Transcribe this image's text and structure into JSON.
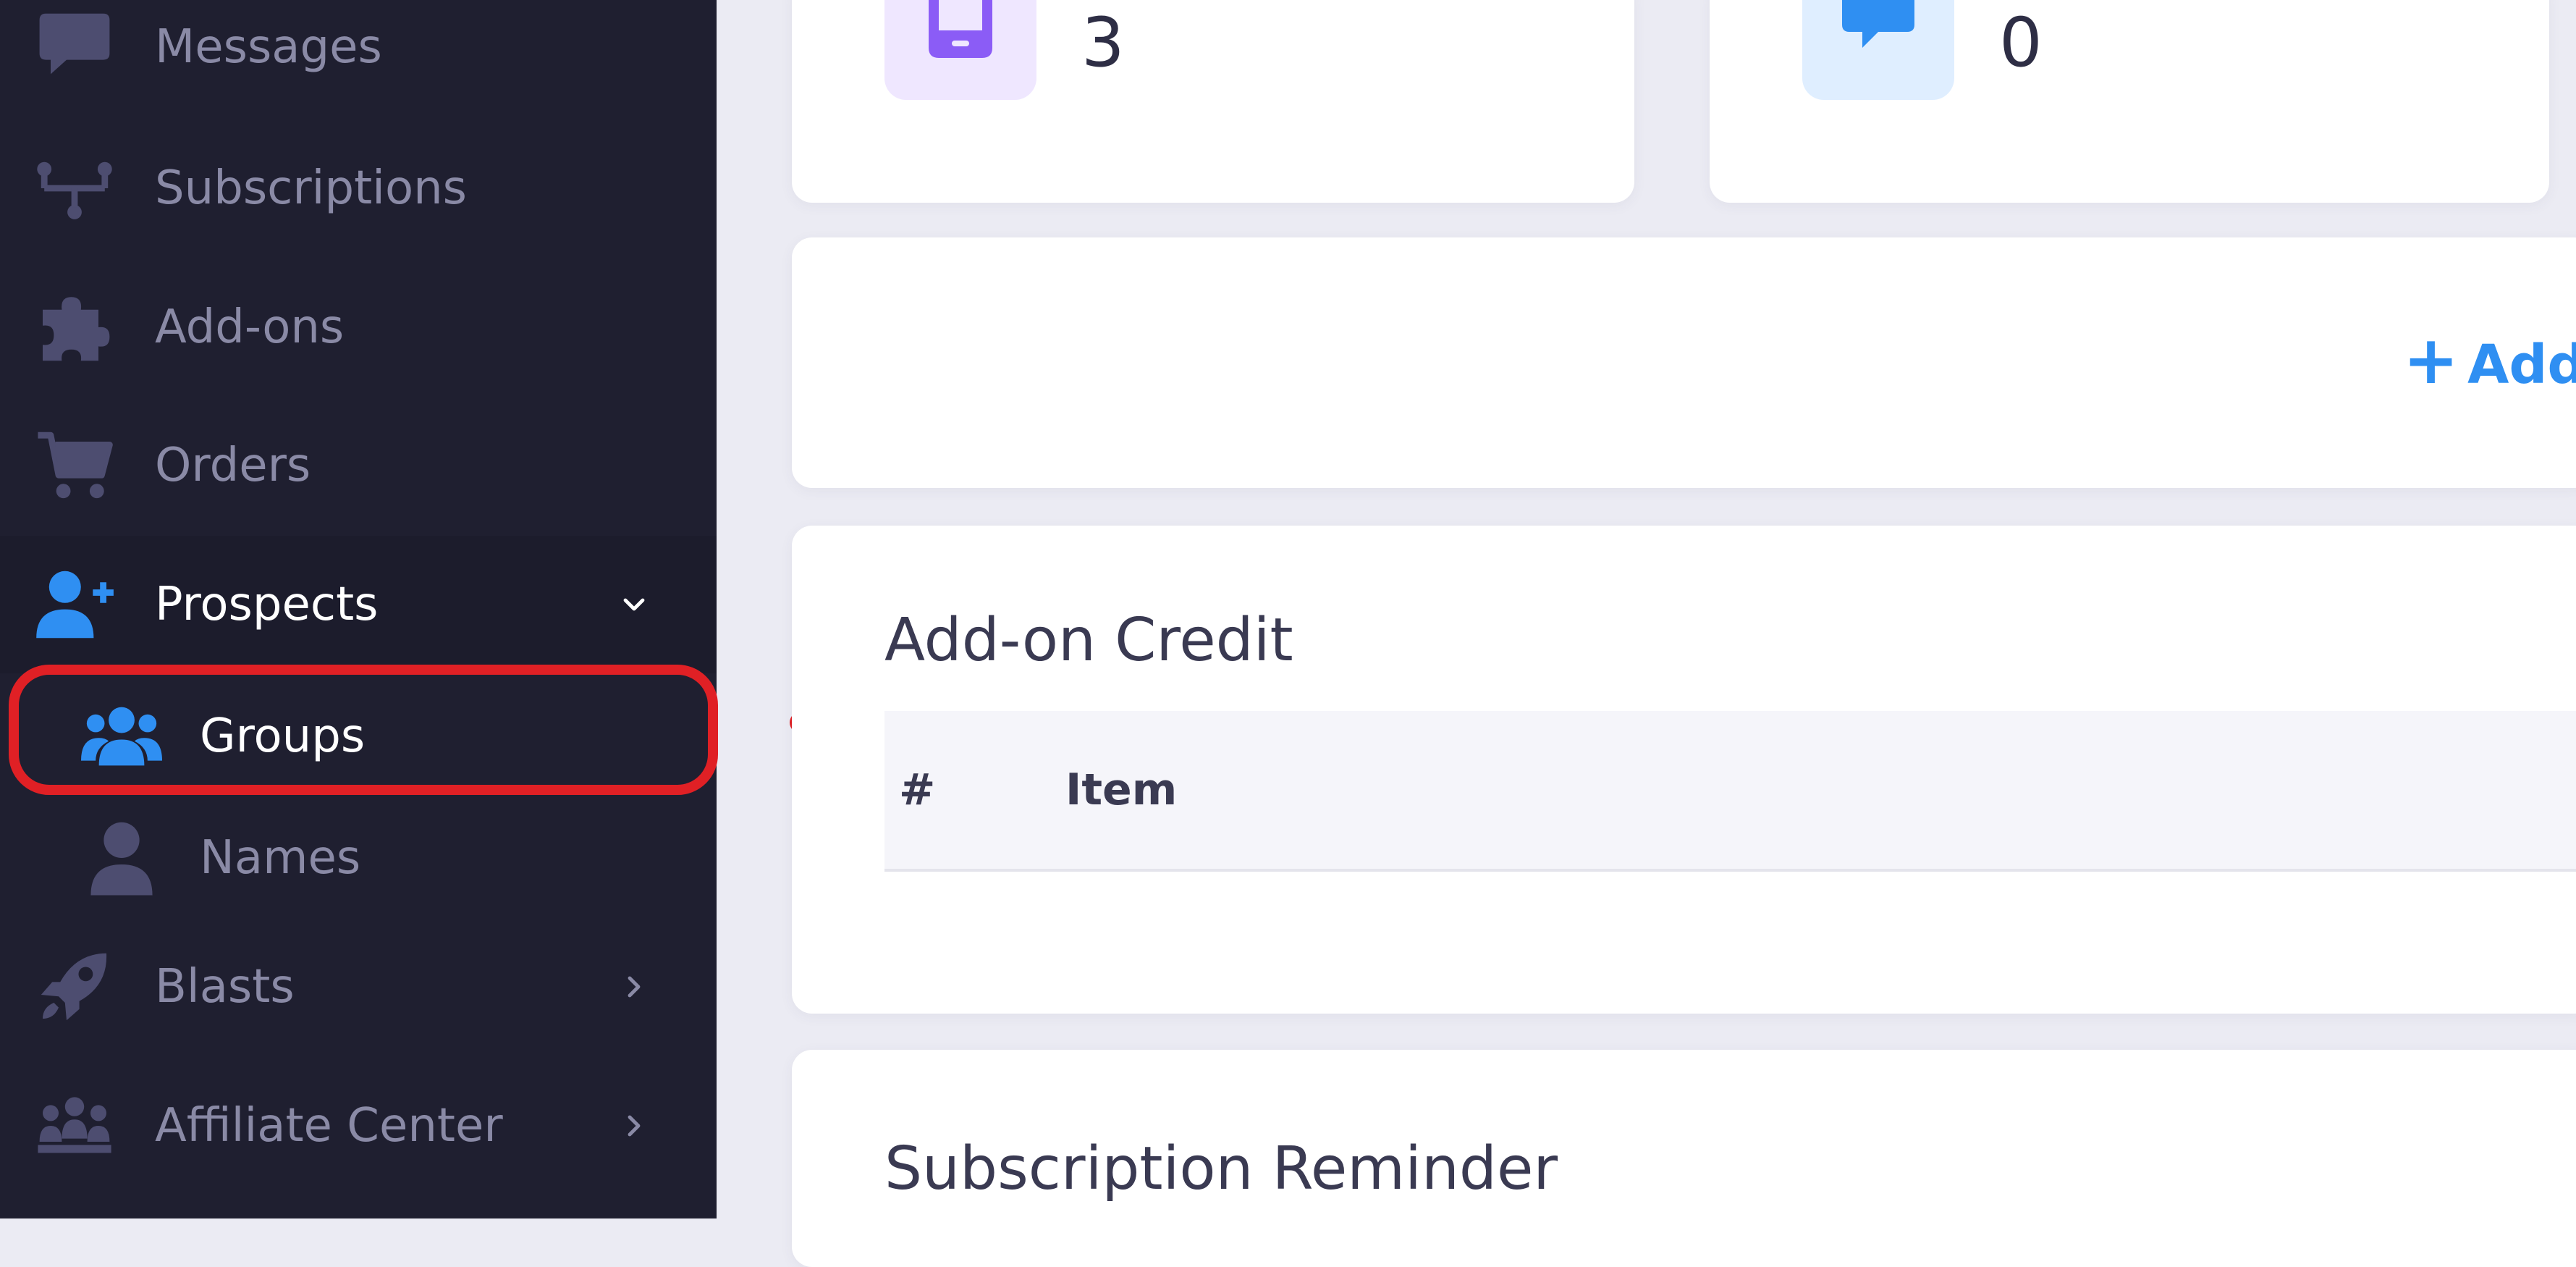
{
  "sidebar": {
    "items": [
      {
        "label": "Messages",
        "icon": "chat-bubble-icon"
      },
      {
        "label": "Subscriptions",
        "icon": "sitemap-icon"
      },
      {
        "label": "Add-ons",
        "icon": "puzzle-icon"
      },
      {
        "label": "Orders",
        "icon": "cart-icon"
      },
      {
        "label": "Prospects",
        "icon": "user-plus-icon",
        "expanded": true
      },
      {
        "label": "Blasts",
        "icon": "rocket-icon"
      },
      {
        "label": "Affiliate Center",
        "icon": "people-group-icon"
      }
    ],
    "prospects_sub": [
      {
        "label": "Groups",
        "icon": "users-icon",
        "active": true
      },
      {
        "label": "Names",
        "icon": "user-icon"
      }
    ]
  },
  "stats": [
    {
      "value": "3",
      "icon": "mobile-phone-icon"
    },
    {
      "value": "0",
      "icon": "message-icon"
    }
  ],
  "actions": {
    "add_label": "Add"
  },
  "credit_section": {
    "title": "Add-on Credit",
    "columns": [
      "#",
      "Item"
    ]
  },
  "reminder_section": {
    "title": "Subscription Reminder"
  },
  "colors": {
    "sidebar_bg": "#1f1f30",
    "accent_blue": "#2f8ff2",
    "highlight_red": "#e02025",
    "phone_purple": "#8b5cf6"
  }
}
